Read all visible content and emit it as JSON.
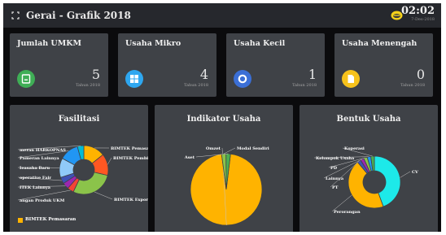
{
  "app": {
    "title": "Gerai - Grafik 2018",
    "time": "02:02",
    "date": "7-Des-2018"
  },
  "cards": [
    {
      "title": "Jumlah UMKM",
      "value": "5",
      "sub": "Tahun 2018",
      "icon": "id-card-icon",
      "color": "#3fae56"
    },
    {
      "title": "Usaha Mikro",
      "value": "4",
      "sub": "Tahun 2018",
      "icon": "grid-icon",
      "color": "#2ea7f0"
    },
    {
      "title": "Usaha Kecil",
      "value": "1",
      "sub": "Tahun 2018",
      "icon": "record-icon",
      "color": "#3b6fd6"
    },
    {
      "title": "Usaha Menengah",
      "value": "0",
      "sub": "Tahun 2018",
      "icon": "document-icon",
      "color": "#f7c21b"
    }
  ],
  "panels": {
    "fasilitasi": {
      "title": "Fasilitasi",
      "legend_label": "BIMTEK Pemasaran"
    },
    "indikator": {
      "title": "Indikator Usaha"
    },
    "bentuk": {
      "title": "Bentuk Usaha"
    }
  },
  "chart_data": [
    {
      "type": "pie",
      "title": "Fasilitasi",
      "labels": [
        "BIMTEK Pemasaran",
        "BIMTEK Pembi",
        "BIMTEK Export",
        "angan Produk UKM",
        "ITEK Lainnya",
        "operative Fair",
        "Ieasaha Baru",
        "Pameran Lainnya",
        "meran HARKOPNAS"
      ],
      "values": [
        1,
        1,
        2,
        0.3,
        0.3,
        0.3,
        0.9,
        0.9,
        0.3
      ],
      "colors": [
        "#ffb300",
        "#ff5722",
        "#8bc34a",
        "#f44336",
        "#9c27b0",
        "#3f51b5",
        "#90caf9",
        "#2196f3",
        "#00bcd4"
      ],
      "legend": "bottom-left"
    },
    {
      "type": "pie",
      "title": "Indikator Usaha",
      "labels": [
        "Omzet",
        "Modal Sendiri",
        "Aset"
      ],
      "values": [
        96,
        2,
        2
      ],
      "colors": [
        "#ffb300",
        "#8bc34a",
        "#4caf50"
      ]
    },
    {
      "type": "pie",
      "title": "Bentuk Usaha",
      "labels": [
        "CV",
        "Perorangan",
        "PT",
        "Lainnya",
        "PD",
        "Kelompok Usaha",
        "Koperasi"
      ],
      "values": [
        2,
        2,
        0.1,
        0.1,
        0.1,
        0.1,
        0.1
      ],
      "colors": [
        "#1de9e9",
        "#ffb300",
        "#3f51b5",
        "#9c27b0",
        "#8bc34a",
        "#2196f3",
        "#4caf50"
      ]
    }
  ]
}
